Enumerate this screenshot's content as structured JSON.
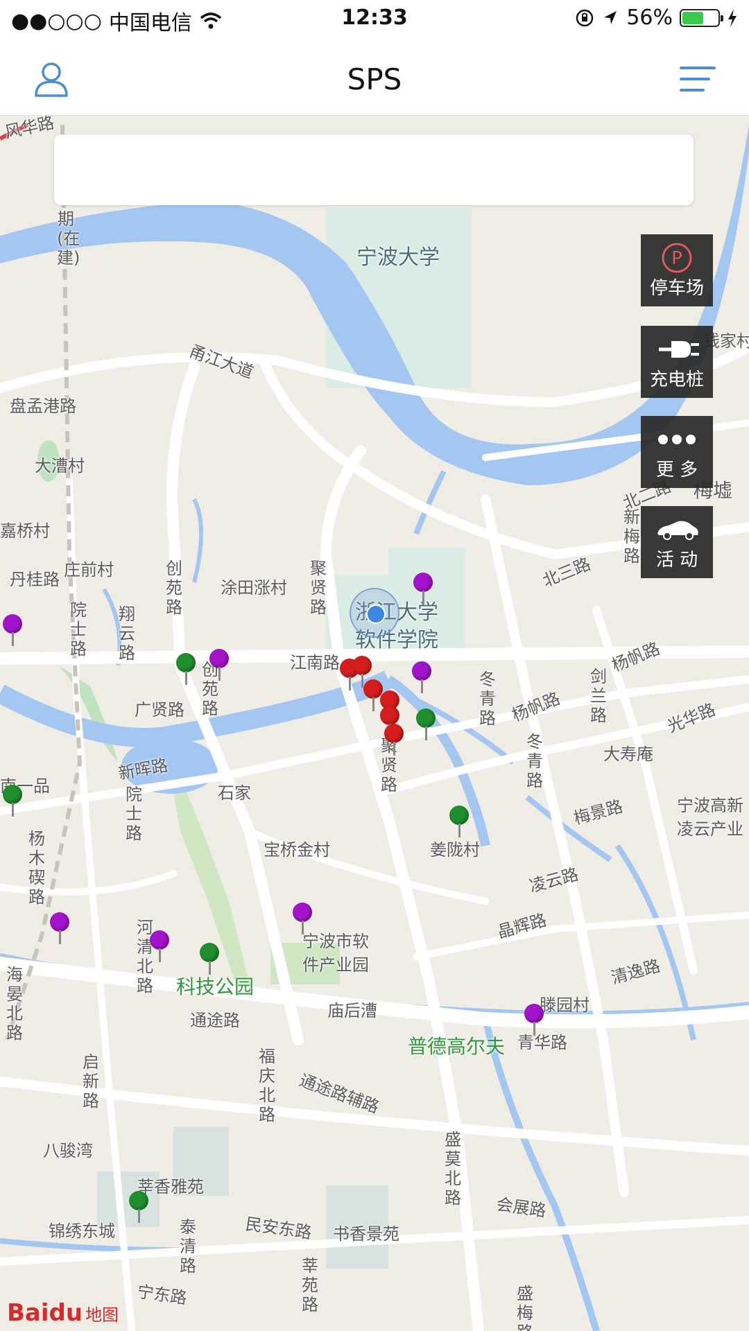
{
  "status_bar": {
    "signal": "●●○○○",
    "carrier": "中国电信",
    "time": "12:33",
    "battery": "56%",
    "battery_level": 0.56
  },
  "header": {
    "title": "SPS",
    "left_icon": "user-icon",
    "right_icon": "menu-icon"
  },
  "search": {
    "placeholder": ""
  },
  "side_buttons": [
    {
      "label": "停车场",
      "icon": "parking-icon"
    },
    {
      "label": "充电桩",
      "icon": "charging-plug-icon"
    },
    {
      "label": "更 多",
      "icon": "more-dots-icon"
    },
    {
      "label": "活 动",
      "icon": "car-icon"
    }
  ],
  "map_labels": {
    "ningbo_univ": "宁波大学",
    "zju_software_1": "浙江大学",
    "zju_software_2": "软件学院",
    "yongjiang": "甬江大道",
    "panmeng": "盘孟港路",
    "dacao": "大漕村",
    "jiaqiao": "嘉桥村",
    "dangui": "丹桂路",
    "zhuangqian": "庄前村",
    "tutianzhang": "涂田涨村",
    "jiangnan": "江南路",
    "guangxian": "广贤路",
    "xinhui": "新晖路",
    "shijia": "石家",
    "baoqiao": "宝桥金村",
    "jianglong": "姜陇村",
    "dashouan": "大寿庵",
    "ningbo_gaoxin_1": "宁波高新",
    "ningbo_gaoxin_2": "凌云产业",
    "meijing": "梅景路",
    "lingyun": "凌云路",
    "jinghui": "晶辉路",
    "qingyi": "清逸路",
    "tengyuan": "滕园村",
    "qinghua": "青华路",
    "puder": "普德高尔夫",
    "miaohoucao": "庙后漕",
    "keji_park": "科技公园",
    "ruanjian_park_1": "宁波市软",
    "ruanjian_park_2": "件产业园",
    "tongtu": "通途路",
    "tongtu_fu": "通途路辅路",
    "bajunwan": "八骏湾",
    "xinxiang": "莘香雅苑",
    "jinxiu": "锦绣东城",
    "minan": "民安东路",
    "shuxiang": "书香景苑",
    "ningdong": "宁东路",
    "huizhan": "会展路",
    "yangfan": "杨帆路",
    "yangfan2": "杨帆路",
    "guanghua": "光华路",
    "beisan": "北三路",
    "beier": "北二路",
    "meixu": "梅墟",
    "qianjia": "钱家村",
    "feng": "风华路",
    "guangqian": "南一品"
  },
  "vertical_labels": {
    "chuangyuan": "创苑路",
    "chuangyuan2": "创苑路",
    "xiangyun": "翔云路",
    "yuanshi": "院士路",
    "yuanshi2": "院士路",
    "juxian": "聚贤路",
    "juxian2": "聚贤路",
    "dongqing": "冬青路",
    "dongqing2": "冬青路",
    "jianlan": "剑兰路",
    "xinmei": "新梅路",
    "yangmu": "杨木碶路",
    "haiyan": "海晏北路",
    "qixin": "启新路",
    "heqing": "河清北路",
    "fuqing": "福庆北路",
    "shengmo": "盛莫北路",
    "taiqing": "泰清路",
    "xinyuan": "莘苑路",
    "shengmei": "盛梅路",
    "construction": "期(在建)"
  },
  "map_attribution": {
    "logo": "Baidu",
    "word": "地图"
  },
  "colors": {
    "water": "#a4c7f2",
    "land": "#f0ede6",
    "road": "#ffffff",
    "green": "#bfe3c0",
    "campus": "#dbece5",
    "pin_purple": "#a313c9",
    "pin_green": "#1f8e2c",
    "pin_red": "#d41d1d",
    "accent": "#4a8fd4"
  }
}
